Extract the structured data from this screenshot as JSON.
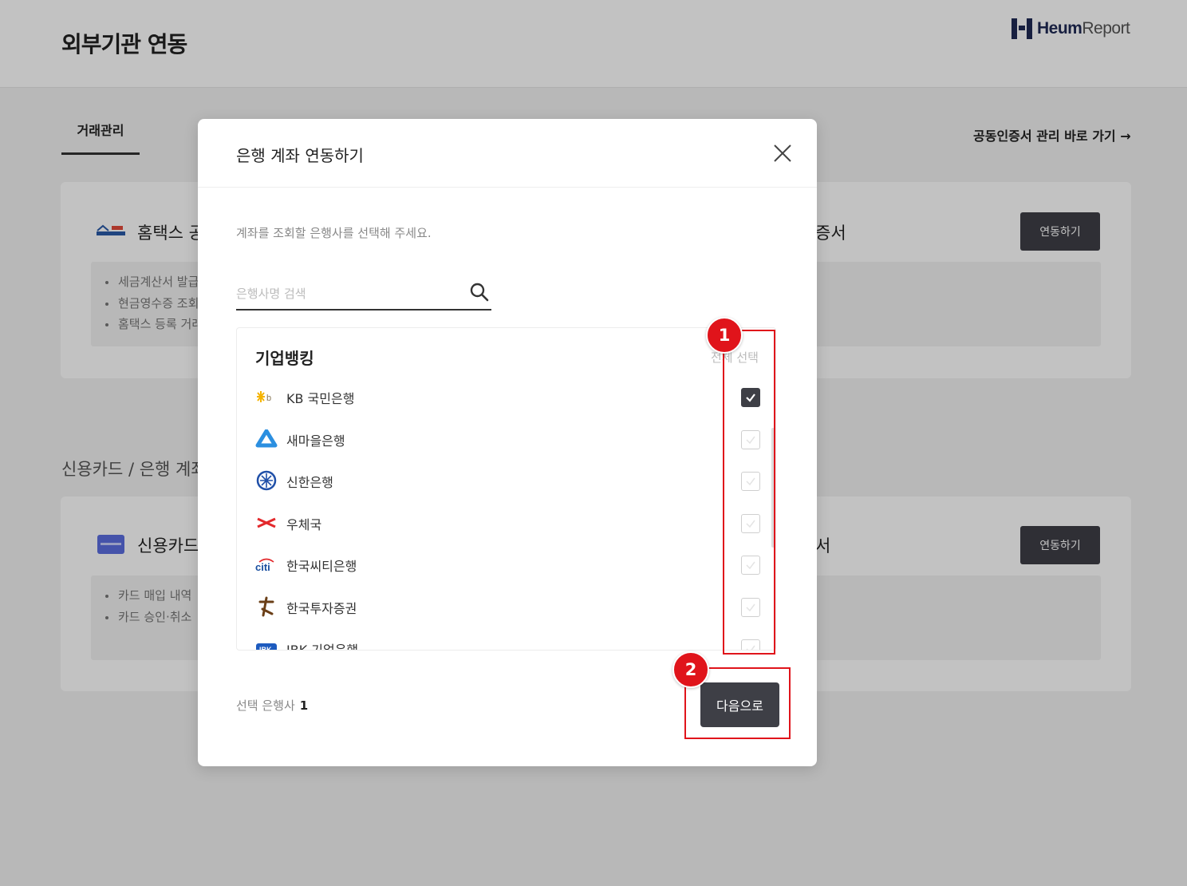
{
  "page": {
    "title": "외부기관 연동",
    "logo_bold": "Heum",
    "logo_light": "Report",
    "tab_label": "거래관리",
    "cert_link": "공동인증서 관리 바로 가기 →",
    "section_label": "신용카드 / 은행 계좌",
    "hometax_card": {
      "title": "홈택스 공",
      "title_tail": "증서",
      "button": "연동하기",
      "bullets": [
        "세금계산서 발급",
        "현금영수증 조회",
        "홈택스 등록 거래"
      ]
    },
    "credit_card": {
      "title": "신용카드",
      "title_tail": "서",
      "button": "연동하기",
      "bullets": [
        "카드 매입 내역",
        "카드 승인·취소"
      ]
    }
  },
  "modal": {
    "title": "은행 계좌 연동하기",
    "instruction": "계좌를 조회할 은행사를 선택해 주세요.",
    "search_placeholder": "은행사명 검색",
    "group_title": "기업뱅킹",
    "select_all": "전체 선택",
    "banks": [
      {
        "name": "KB 국민은행",
        "logo": "kb-logo-icon",
        "checked": true
      },
      {
        "name": "새마을은행",
        "logo": "mg-logo-icon",
        "checked": false
      },
      {
        "name": "신한은행",
        "logo": "shinhan-logo-icon",
        "checked": false
      },
      {
        "name": "우체국",
        "logo": "post-logo-icon",
        "checked": false
      },
      {
        "name": "한국씨티은행",
        "logo": "citi-logo-icon",
        "checked": false
      },
      {
        "name": "한국투자증권",
        "logo": "korea-investment-logo-icon",
        "checked": false
      },
      {
        "name": "IBK 기업은행",
        "logo": "ibk-logo-icon",
        "checked": false
      }
    ],
    "selected_label": "선택 은행사",
    "selected_count": "1",
    "next_button": "다음으로"
  },
  "annotations": {
    "badge_1": "1",
    "badge_2": "2",
    "color": "#e0141b"
  },
  "colors": {
    "primary_button": "#3e3f46",
    "overlay": "rgba(0,0,0,0.24)"
  }
}
